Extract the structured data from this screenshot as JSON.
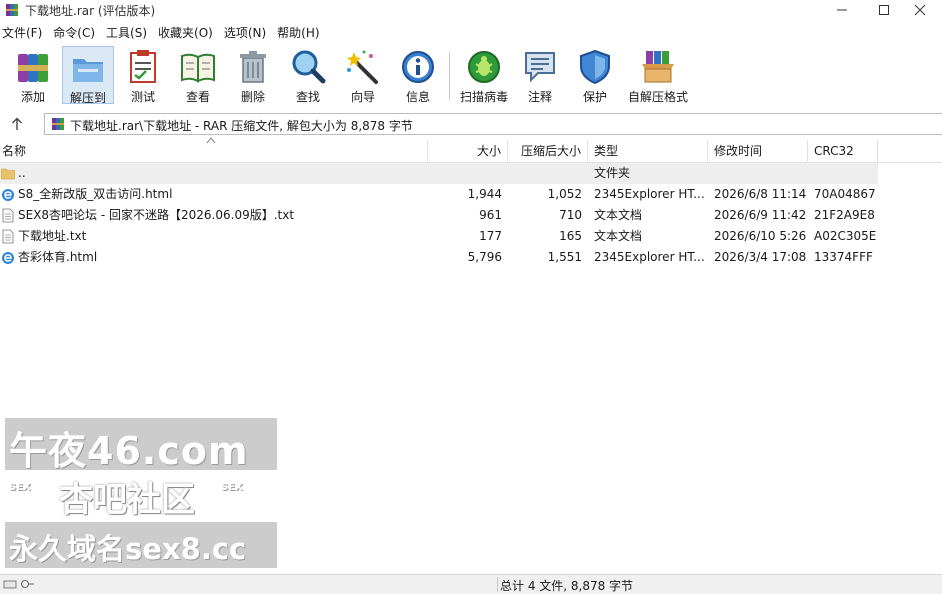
{
  "window": {
    "title": "下载地址.rar (评估版本)"
  },
  "menu": [
    "文件(F)",
    "命令(C)",
    "工具(S)",
    "收藏夹(O)",
    "选项(N)",
    "帮助(H)"
  ],
  "toolbar": [
    {
      "label": "添加",
      "icon": "add-archive-icon"
    },
    {
      "label": "解压到",
      "icon": "extract-to-icon",
      "active": true
    },
    {
      "label": "测试",
      "icon": "test-icon"
    },
    {
      "label": "查看",
      "icon": "view-book-icon"
    },
    {
      "label": "删除",
      "icon": "trash-icon"
    },
    {
      "label": "查找",
      "icon": "magnifier-icon"
    },
    {
      "label": "向导",
      "icon": "wizard-wand-icon"
    },
    {
      "label": "信息",
      "icon": "info-icon"
    },
    {
      "label": "扫描病毒",
      "icon": "virus-scan-icon"
    },
    {
      "label": "注释",
      "icon": "comment-icon"
    },
    {
      "label": "保护",
      "icon": "shield-icon"
    },
    {
      "label": "自解压格式",
      "icon": "sfx-box-icon"
    }
  ],
  "address": {
    "path": "下载地址.rar\\下载地址 - RAR 压缩文件, 解包大小为 8,878 字节"
  },
  "columns": [
    "名称",
    "大小",
    "压缩后大小",
    "类型",
    "修改时间",
    "CRC32"
  ],
  "files": [
    {
      "name": "..",
      "size": "",
      "packed": "",
      "type": "文件夹",
      "modified": "",
      "crc": "",
      "icon": "folder-icon"
    },
    {
      "name": "S8_全新改版_双击访问.html",
      "size": "1,944",
      "packed": "1,052",
      "type": "2345Explorer HT...",
      "modified": "2026/6/8 11:14",
      "crc": "70A04867",
      "icon": "browser-html-icon"
    },
    {
      "name": "SEX8杏吧论坛 - 回家不迷路【2026.06.09版】.txt",
      "size": "961",
      "packed": "710",
      "type": "文本文档",
      "modified": "2026/6/9 11:42",
      "crc": "21F2A9E8",
      "icon": "text-file-icon"
    },
    {
      "name": "下载地址.txt",
      "size": "177",
      "packed": "165",
      "type": "文本文档",
      "modified": "2026/6/10 5:26",
      "crc": "A02C305E",
      "icon": "text-file-icon"
    },
    {
      "name": "杏彩体育.html",
      "size": "5,796",
      "packed": "1,551",
      "type": "2345Explorer HT...",
      "modified": "2026/3/4 17:08",
      "crc": "13374FFF",
      "icon": "browser-html-icon"
    }
  ],
  "watermark": {
    "line1": "午夜46.com",
    "line2": "杏吧社区",
    "line2_side": "SEX",
    "line3": "永久域名sex8.cc"
  },
  "status": {
    "text": "总计 4 文件, 8,878 字节"
  }
}
